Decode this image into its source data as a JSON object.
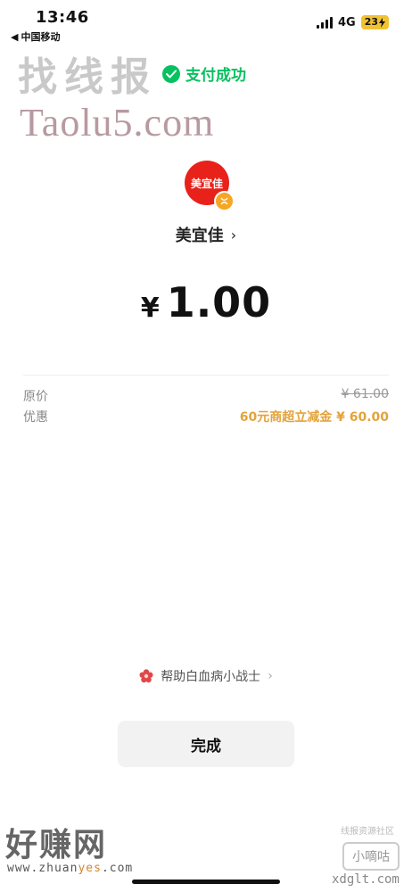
{
  "status_bar": {
    "time": "13:46",
    "carrier_back": "◀",
    "carrier": "中国移动",
    "network": "4G",
    "battery": "23"
  },
  "watermarks": {
    "top_title": "找线报",
    "top_url": "Taolu5.com",
    "bottom_title": "好赚网",
    "bottom_url_prefix": "www.zhuan",
    "bottom_url_highlight": "yes",
    "bottom_url_suffix": ".com",
    "corner_caption": "线报资源社区",
    "corner_badge": "小嘀咕",
    "corner_url": "xdglt.com"
  },
  "payment": {
    "status": "支付成功",
    "merchant_logo_text": "美宜佳",
    "merchant_name": "美宜佳",
    "currency": "¥",
    "amount": "1.00"
  },
  "details": [
    {
      "label": "原价",
      "value": "¥ 61.00"
    },
    {
      "label": "优惠",
      "value": "60元商超立减金 ¥ 60.00"
    }
  ],
  "charity": {
    "text": "帮助白血病小战士"
  },
  "done_button": {
    "label": "完成"
  },
  "colors": {
    "success_green": "#07c160",
    "merchant_red": "#e8221a",
    "discount_orange": "#e3a33a",
    "battery_yellow": "#f1c232"
  }
}
